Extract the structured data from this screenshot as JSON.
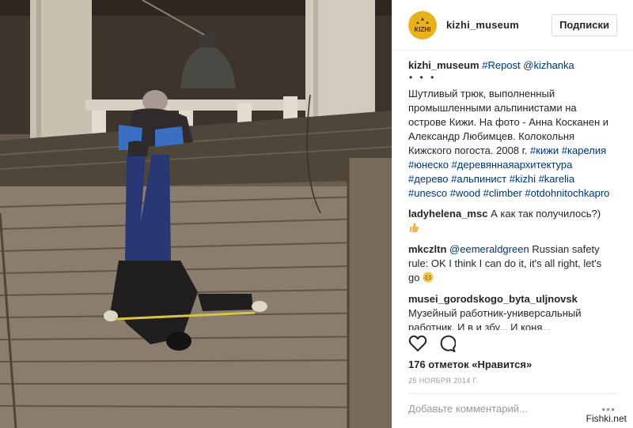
{
  "post": {
    "username": "kizhi_museum",
    "follow_label": "Подписки",
    "logo_text": "KIZHI"
  },
  "caption": {
    "username": "kizhi_museum",
    "repost_tag": "#Repost",
    "repost_user": "@kizhanka",
    "dots": "• • •",
    "text": "Шутливый трюк, выполненный промышленными альпинистами на острове Кижи. На фото - Анна Косканен и Александр Любимцев. Колокольня Кижского погоста. 2008 г.",
    "hashtags": "#кижи #карелия #юнеско #деревяннаяархитектура #дерево #альпинист #kizhi #karelia #unesco #wood #climber #otdohnitochkapro"
  },
  "comments": [
    {
      "user": "ladyhelena_msc",
      "text": "А как так получилось?)",
      "emoji": "thumbs-up"
    },
    {
      "user": "mkczltn",
      "mention": "@eemeraldgreen",
      "text": "Russian safety rule: OK I think I can do it, it's all right, let's go",
      "emoji": "grinning-face"
    },
    {
      "user": "musei_gorodskogo_byta_uljnovsk",
      "text": "Музейный работник-универсальный работник. И в и збу... И коня..."
    }
  ],
  "likes": "176 отметок «Нравится»",
  "date": "25 НОЯБРЯ 2014 Г.",
  "add_comment_placeholder": "Добавьте комментарий...",
  "more_menu": "•••",
  "watermark": "Fishki.net",
  "colors": {
    "hashtag": "#003569",
    "logo_bg": "#e8b21e",
    "text": "#262626",
    "muted": "#999999"
  }
}
